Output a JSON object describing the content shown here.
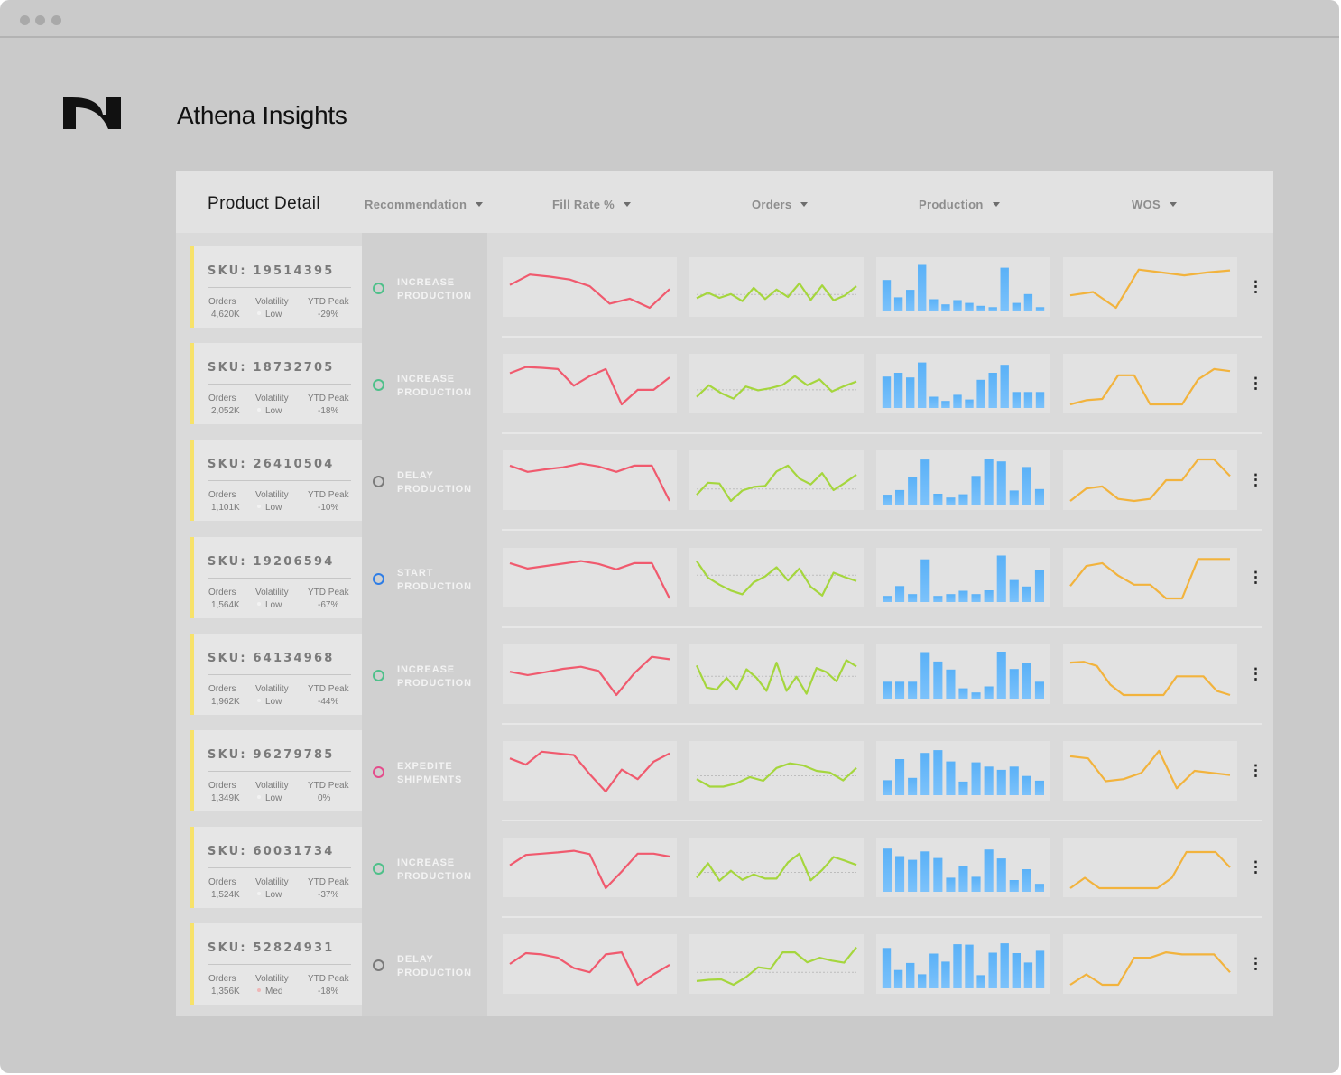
{
  "window": {
    "controls": [
      "close",
      "minimize",
      "maximize"
    ]
  },
  "app": {
    "title": "Athena Insights",
    "logo": "N-logo"
  },
  "header": {
    "title": "Product Detail",
    "columns": [
      {
        "label": "Recommendation"
      },
      {
        "label": "Fill Rate %"
      },
      {
        "label": "Orders"
      },
      {
        "label": "Production"
      },
      {
        "label": "WOS"
      }
    ]
  },
  "metric_labels": {
    "orders": "Orders",
    "volatility": "Volatility",
    "ytd_peak": "YTD Peak"
  },
  "colors": {
    "fill_rate": "#f05a6e",
    "orders": "#a5d63d",
    "production": "#5ab1f7",
    "wos": "#f2b33d",
    "stripe": "#f7e26a",
    "increase": "#4fc08a",
    "delay": "#7a7a7a",
    "start": "#2e7de6",
    "expedite": "#e44d8c"
  },
  "rows": [
    {
      "sku": "SKU: 19514395",
      "orders": "4,620K",
      "volatility": "Low",
      "ytd_peak": "-29%",
      "recommendation": "INCREASE PRODUCTION",
      "rec_type": "increase",
      "fill_rate": [
        5.5,
        8.0,
        7.5,
        6.8,
        5.2,
        1.0,
        2.2,
        0.0,
        4.5
      ],
      "orders_series": [
        2.3,
        3.6,
        2.4,
        3.3,
        1.6,
        4.8,
        2.1,
        4.4,
        2.6,
        5.9,
        1.9,
        5.4,
        1.8,
        3.0,
        5.2
      ],
      "orders_avg": 3.2,
      "production": [
        6.7,
        3.0,
        4.6,
        9.9,
        2.6,
        1.5,
        2.4,
        1.8,
        1.2,
        0.9,
        9.3,
        1.8,
        3.7,
        0.9
      ],
      "wos": [
        3.0,
        3.8,
        0.0,
        9.2,
        8.5,
        7.8,
        8.5,
        9.0
      ]
    },
    {
      "sku": "SKU: 18732705",
      "orders": "2,052K",
      "volatility": "Low",
      "ytd_peak": "-18%",
      "recommendation": "INCREASE PRODUCTION",
      "rec_type": "increase",
      "fill_rate": [
        7.5,
        9.0,
        8.8,
        8.5,
        4.5,
        6.8,
        8.5,
        0.0,
        3.5,
        3.5,
        6.5
      ],
      "orders_series": [
        1.8,
        4.6,
        2.7,
        1.4,
        4.3,
        3.4,
        3.9,
        4.7,
        6.8,
        4.6,
        6.0,
        3.1,
        4.4,
        5.5
      ],
      "orders_avg": 3.5,
      "production": [
        6.7,
        7.5,
        6.5,
        9.7,
        2.4,
        1.5,
        2.8,
        1.8,
        6.0,
        7.5,
        9.2,
        3.4,
        3.4,
        3.4
      ],
      "wos": [
        0.0,
        1.0,
        1.3,
        7.0,
        7.0,
        0.0,
        0.0,
        0.0,
        6.0,
        8.5,
        8.0
      ]
    },
    {
      "sku": "SKU: 26410504",
      "orders": "1,101K",
      "volatility": "Low",
      "ytd_peak": "-10%",
      "recommendation": "DELAY PRODUCTION",
      "rec_type": "delay",
      "fill_rate": [
        8.5,
        7.0,
        7.6,
        8.1,
        9.0,
        8.3,
        7.0,
        8.5,
        8.5,
        0.0
      ],
      "orders_series": [
        1.5,
        4.4,
        4.2,
        0.0,
        2.5,
        3.4,
        3.6,
        7.1,
        8.5,
        5.4,
        4.0,
        6.7,
        2.6,
        4.4,
        6.3
      ],
      "orders_avg": 2.9,
      "production": [
        2.1,
        3.1,
        5.9,
        9.6,
        2.3,
        1.5,
        2.2,
        6.1,
        9.7,
        9.2,
        3.0,
        8.0,
        3.3
      ],
      "wos": [
        0.0,
        3.0,
        3.5,
        0.5,
        0.0,
        0.5,
        5.0,
        5.0,
        10.0,
        10.0,
        6.0
      ]
    },
    {
      "sku": "SKU: 19206594",
      "orders": "1,564K",
      "volatility": "Low",
      "ytd_peak": "-67%",
      "recommendation": "START PRODUCTION",
      "rec_type": "start",
      "fill_rate": [
        8.5,
        7.2,
        7.8,
        8.4,
        9.0,
        8.3,
        7.0,
        8.5,
        8.5,
        0.0
      ],
      "orders_series": [
        9.0,
        5.0,
        3.3,
        1.9,
        1.0,
        3.9,
        5.3,
        7.5,
        4.3,
        7.2,
        2.8,
        0.7,
        6.2,
        5.1,
        4.2
      ],
      "orders_avg": 5.6,
      "production": [
        1.3,
        3.4,
        1.7,
        9.1,
        1.3,
        1.7,
        2.4,
        1.7,
        2.5,
        9.9,
        4.7,
        3.3,
        6.8
      ],
      "wos": [
        3.0,
        7.8,
        8.5,
        5.5,
        3.3,
        3.3,
        0.0,
        0.0,
        9.5,
        9.5,
        9.5
      ]
    },
    {
      "sku": "SKU: 64134968",
      "orders": "1,962K",
      "volatility": "Low",
      "ytd_peak": "-44%",
      "recommendation": "INCREASE PRODUCTION",
      "rec_type": "increase",
      "fill_rate": [
        5.6,
        4.8,
        5.5,
        6.3,
        6.8,
        5.8,
        0.0,
        5.2,
        9.2,
        8.6
      ],
      "orders_series": [
        7.1,
        1.8,
        1.3,
        4.1,
        1.3,
        6.2,
        4.1,
        1.0,
        7.8,
        1.0,
        4.4,
        0.3,
        6.5,
        5.5,
        3.3,
        8.4,
        6.9
      ],
      "orders_avg": 4.5,
      "production": [
        3.6,
        3.6,
        3.6,
        9.9,
        7.9,
        6.2,
        2.2,
        1.3,
        2.6,
        10.0,
        6.3,
        7.5,
        3.6
      ],
      "wos": [
        7.8,
        8.0,
        7.0,
        2.5,
        0.0,
        0.0,
        0.0,
        0.0,
        4.5,
        4.5,
        4.5,
        1.0,
        0.0
      ]
    },
    {
      "sku": "SKU: 96279785",
      "orders": "1,349K",
      "volatility": "Low",
      "ytd_peak": "0%",
      "recommendation": "EXPEDITE SHIPMENTS",
      "rec_type": "expedite",
      "fill_rate": [
        8.0,
        6.5,
        9.6,
        9.2,
        8.8,
        4.2,
        0.0,
        5.3,
        3.0,
        7.2,
        9.2
      ],
      "orders_series": [
        3.0,
        1.2,
        1.2,
        2.0,
        3.5,
        2.6,
        5.7,
        6.8,
        6.3,
        5.0,
        4.6,
        2.7,
        5.7
      ],
      "orders_avg": 3.8,
      "production": [
        3.2,
        7.7,
        3.7,
        9.0,
        9.6,
        7.2,
        2.9,
        7.0,
        6.1,
        5.4,
        6.1,
        4.1,
        3.1
      ],
      "wos": [
        8.5,
        8.0,
        2.5,
        3.0,
        4.5,
        9.8,
        0.8,
        5.0,
        4.5,
        4.0
      ]
    },
    {
      "sku": "SKU: 60031734",
      "orders": "1,524K",
      "volatility": "Low",
      "ytd_peak": "-37%",
      "recommendation": "INCREASE PRODUCTION",
      "rec_type": "increase",
      "fill_rate": [
        5.5,
        8.0,
        8.3,
        8.6,
        9.0,
        8.2,
        0.0,
        4.0,
        8.3,
        8.3,
        7.6
      ],
      "orders_series": [
        2.5,
        6.0,
        1.8,
        4.2,
        2.0,
        3.3,
        2.3,
        2.3,
        6.2,
        8.3,
        1.9,
        4.4,
        7.5,
        6.6,
        5.6
      ],
      "orders_avg": 3.8,
      "production": [
        9.2,
        7.6,
        6.8,
        8.6,
        7.2,
        3.0,
        5.5,
        3.2,
        9.0,
        7.1,
        2.5,
        4.8,
        1.7
      ],
      "wos": [
        0.0,
        2.5,
        0.0,
        0.0,
        0.0,
        0.0,
        0.0,
        2.5,
        8.7,
        8.7,
        8.7,
        5.0
      ]
    },
    {
      "sku": "SKU: 52824931",
      "orders": "1,356K",
      "volatility": "Med",
      "ytd_peak": "-18%",
      "recommendation": "DELAY PRODUCTION",
      "rec_type": "delay",
      "fill_rate": [
        5.0,
        7.6,
        7.3,
        6.5,
        4.0,
        3.0,
        7.3,
        7.8,
        0.0,
        2.5,
        4.8
      ],
      "orders_series": [
        0.9,
        1.2,
        1.3,
        0.0,
        1.8,
        4.2,
        3.8,
        7.8,
        7.8,
        5.4,
        6.5,
        5.8,
        5.3,
        9.0
      ],
      "orders_avg": 3.0,
      "production": [
        8.6,
        3.9,
        5.4,
        3.0,
        7.4,
        5.7,
        9.4,
        9.3,
        2.8,
        7.6,
        9.6,
        7.5,
        5.5,
        8.0
      ],
      "wos": [
        0.0,
        2.5,
        0.0,
        0.0,
        6.5,
        6.5,
        7.8,
        7.3,
        7.3,
        7.3,
        3.0
      ]
    }
  ]
}
